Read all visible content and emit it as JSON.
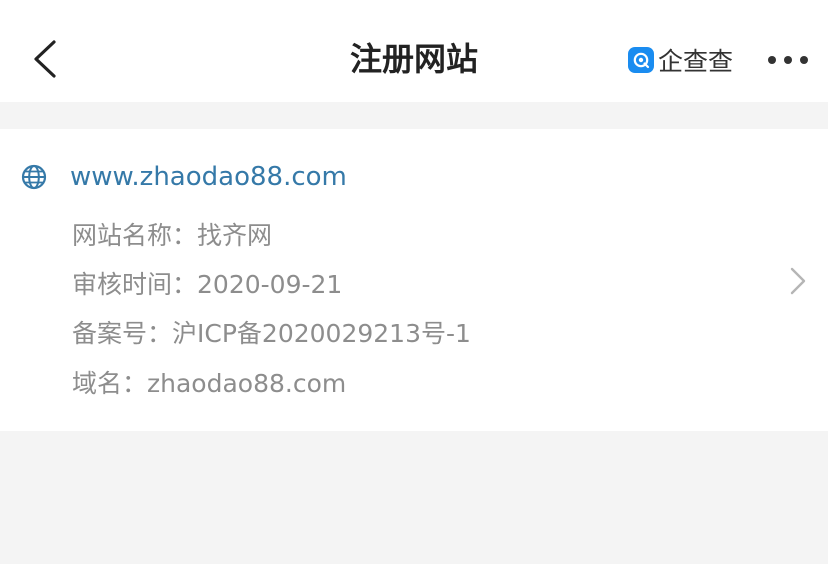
{
  "header": {
    "title": "注册网站",
    "brand_name": "企查查"
  },
  "site": {
    "url": "www.zhaodao88.com",
    "name_label": "网站名称：",
    "name_value": "找齐网",
    "review_label": "审核时间：",
    "review_value": "2020-09-21",
    "icp_label": "备案号：",
    "icp_value": "沪ICP备2020029213号-1",
    "domain_label": "域名：",
    "domain_value": "zhaodao88.com"
  },
  "colors": {
    "link": "#3579a8",
    "muted_text": "#8d8d8d",
    "brand": "#1a8cf0",
    "page_background": "#f4f4f4"
  },
  "icons": [
    "back-arrow-icon",
    "brand-logo-icon",
    "more-icon",
    "globe-icon",
    "chevron-right-icon"
  ]
}
